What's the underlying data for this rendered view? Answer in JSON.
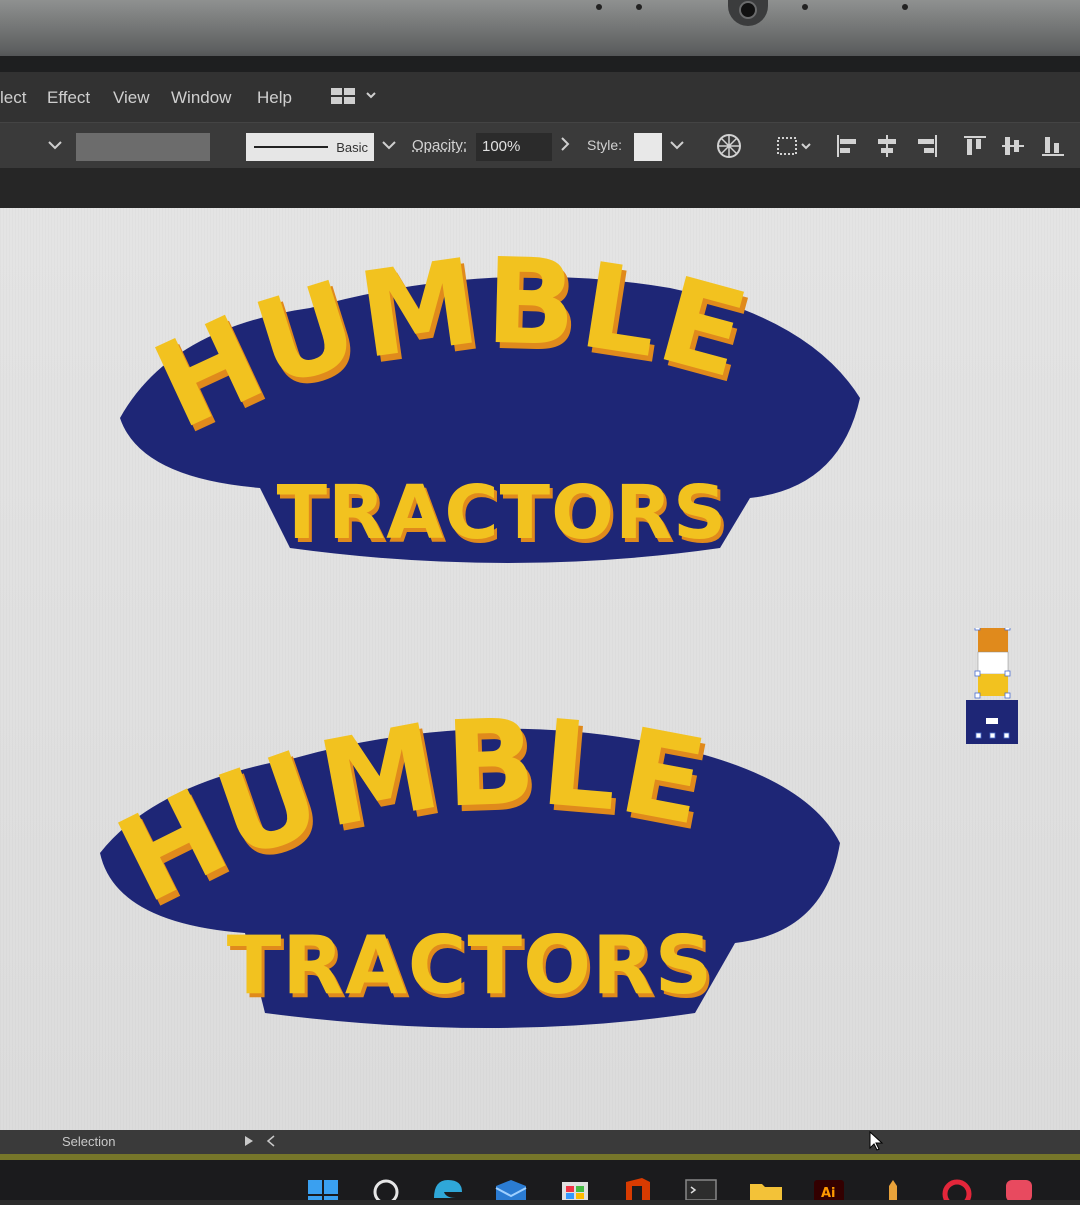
{
  "menubar": {
    "items": [
      "lect",
      "Effect",
      "View",
      "Window",
      "Help"
    ]
  },
  "controlbar": {
    "stroke_profile": "Basic",
    "opacity_label": "Opacity:",
    "opacity_value": "100%",
    "style_label": "Style:"
  },
  "canvas": {
    "logos": [
      {
        "line1": "HUMBLE",
        "line2": "TRACTORS"
      },
      {
        "line1": "HUMBLE",
        "line2": "TRACTORS"
      }
    ]
  },
  "statusbar": {
    "tool": "Selection"
  },
  "colors": {
    "navy": "#1e2676",
    "yellow": "#f2c21f",
    "shadow": "#e08a1c",
    "canvas": "#e0e0e0"
  },
  "icons": [
    "layout-icon",
    "recolor-icon",
    "align-left-icon",
    "align-center-icon",
    "align-right-icon",
    "align-top-icon",
    "align-middle-icon",
    "align-bottom-icon",
    "windows-icon",
    "search-icon",
    "edge-icon",
    "mail-icon",
    "store-icon",
    "office-icon",
    "terminal-icon",
    "folder-icon",
    "illustrator-icon"
  ]
}
